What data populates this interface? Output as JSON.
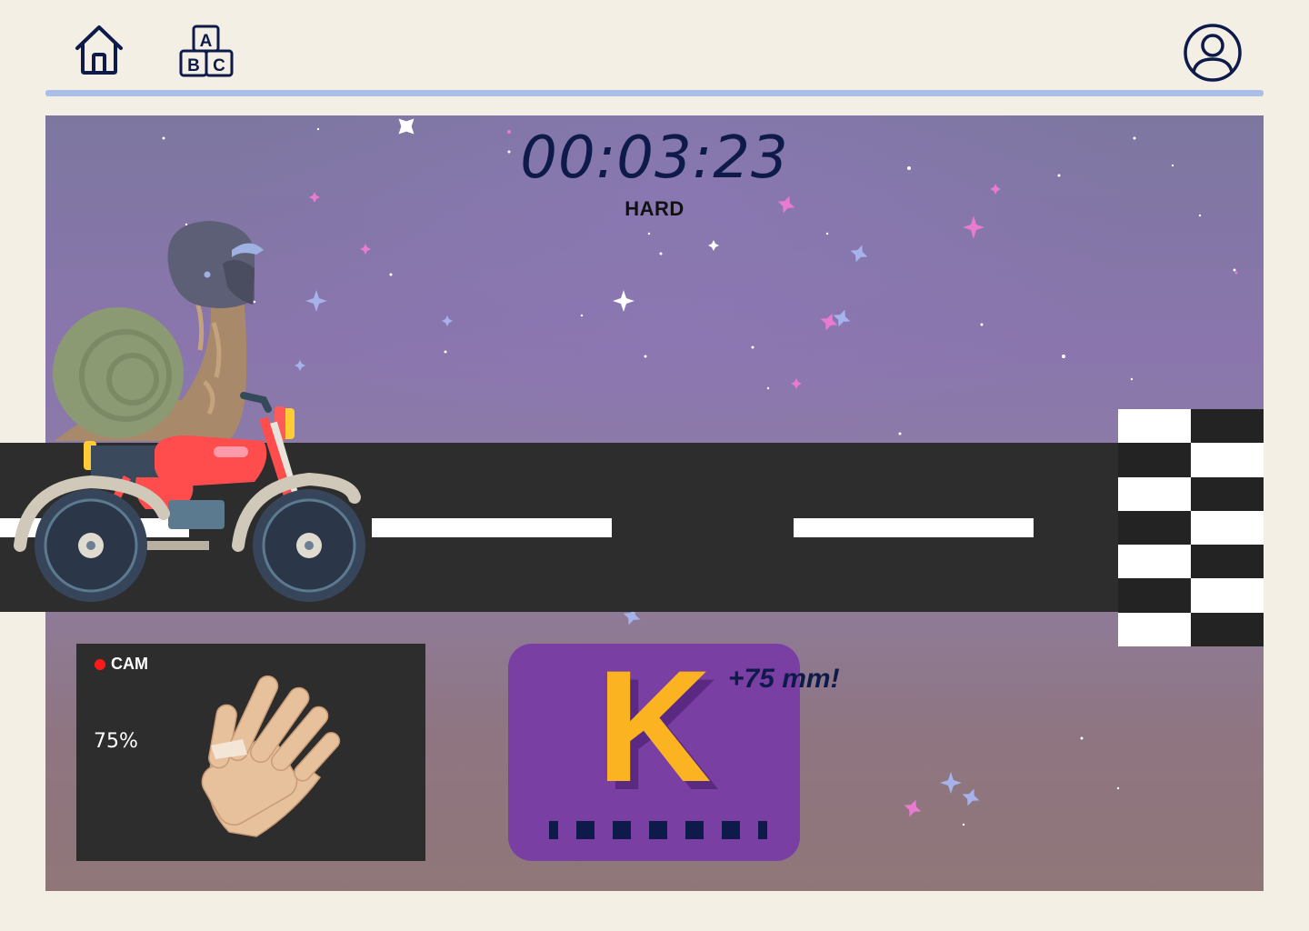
{
  "nav": {
    "home_icon": "home-icon",
    "abc_icon": "abc-blocks-icon",
    "abc_letters": [
      "A",
      "B",
      "C"
    ],
    "profile_icon": "user-profile-icon"
  },
  "game": {
    "timer": "00:03:23",
    "difficulty": "HARD",
    "character": "snail-riding-motorcycle",
    "finish_line": "checkered-flag"
  },
  "camera": {
    "label": "CAM",
    "confidence": "75%",
    "recording_color": "#ff1a1a"
  },
  "letter_card": {
    "letter": "K",
    "bonus": "+75 mm!",
    "progress_segments": 7
  },
  "colors": {
    "background": "#f3efe4",
    "divider": "#a9bfe8",
    "navy": "#0e1a4a",
    "card_purple": "#7a3fa3",
    "letter_yellow": "#fbb321",
    "road": "#2d2d2d"
  }
}
